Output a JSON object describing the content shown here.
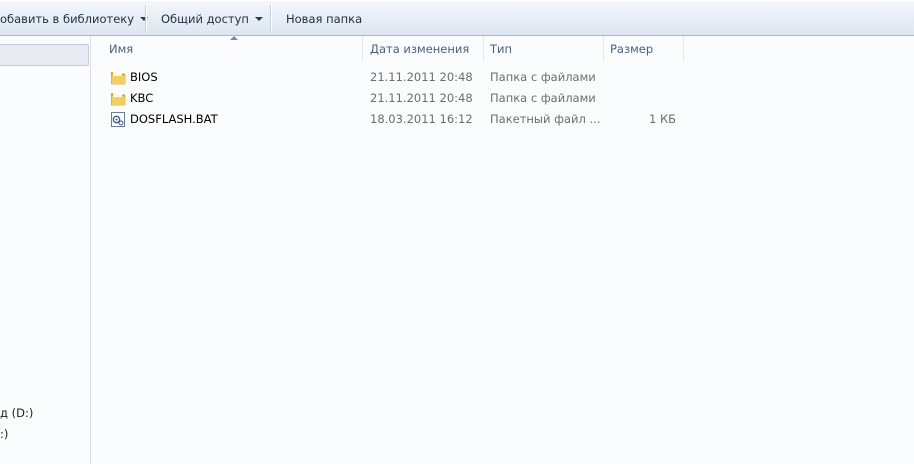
{
  "toolbar": {
    "add_to_library": "обавить в библиотеку",
    "share": "Общий доступ",
    "new_folder": "Новая папка"
  },
  "nav": {
    "drive_d": "д (D:)",
    "drive_e": ":)"
  },
  "columns": {
    "name": "Имя",
    "date": "Дата изменения",
    "type": "Тип",
    "size": "Размер"
  },
  "files": [
    {
      "name": "BIOS",
      "date": "21.11.2011 20:48",
      "type": "Папка с файлами",
      "size": "",
      "icon": "folder-icon"
    },
    {
      "name": "KBC",
      "date": "21.11.2011 20:48",
      "type": "Папка с файлами",
      "size": "",
      "icon": "folder-icon"
    },
    {
      "name": "DOSFLASH.BAT",
      "date": "18.03.2011 16:12",
      "type": "Пакетный файл ...",
      "size": "1 КБ",
      "icon": "batch-file-icon"
    }
  ]
}
